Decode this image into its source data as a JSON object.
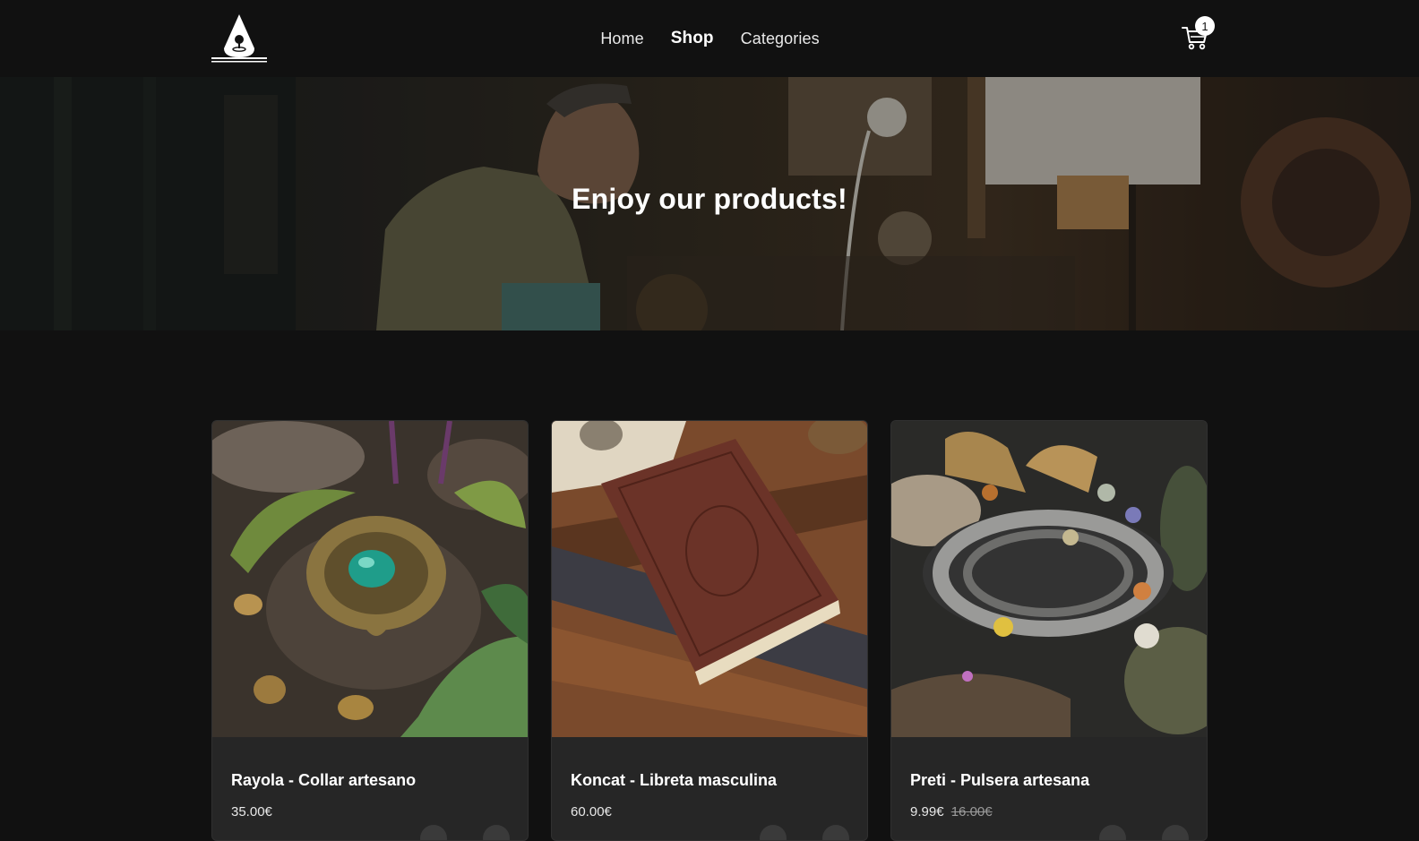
{
  "nav": {
    "logo_icon": "campfire-drop-logo",
    "links": [
      {
        "label": "Home",
        "active": false
      },
      {
        "label": "Shop",
        "active": true
      },
      {
        "label": "Categories",
        "active": false
      }
    ],
    "cart_icon": "shopping-cart-icon",
    "cart_count": "1"
  },
  "hero": {
    "title": "Enjoy our products!",
    "image": "craftsman-in-workshop"
  },
  "products": [
    {
      "name": "Rayola - Collar artesano",
      "price": "35.00€",
      "old_price": "",
      "image": "ornate-pendant-necklace-with-green-gem"
    },
    {
      "name": "Koncat - Libreta masculina",
      "price": "60.00€",
      "old_price": "",
      "image": "brown-leather-notebook-on-wood"
    },
    {
      "name": "Preti - Pulsera artesana",
      "price": "9.99€",
      "old_price": "16.00€",
      "image": "beaded-silver-charm-bracelet"
    }
  ],
  "colors": {
    "background": "#111111",
    "card": "#262626",
    "text": "#ffffff"
  }
}
